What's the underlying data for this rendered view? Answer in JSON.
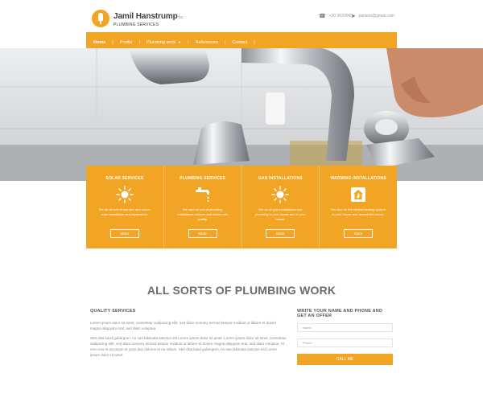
{
  "header": {
    "logo_name": "Jamil Hanstrump",
    "logo_suffix": "f.c.",
    "logo_tagline": "PLUMBING SERVICES",
    "phone": "+30 0020000",
    "email": "jamiem@gmail.com"
  },
  "nav": {
    "items": [
      {
        "label": "Home",
        "active": true
      },
      {
        "label": "Profile"
      },
      {
        "label": "Plumbing work"
      },
      {
        "label": "References"
      },
      {
        "label": "Contact"
      }
    ]
  },
  "hero": {
    "image": "faucet-repair-photo"
  },
  "services": [
    {
      "title": "SOLAR SERVICES",
      "icon": "sun-icon",
      "description": "We do all sort of sun dior and indoor solar installation and reparations.",
      "button": "More"
    },
    {
      "title": "PLUMBING SERVICES",
      "icon": "faucet-icon",
      "description": "We care all sort of plumbing installations outdoor and indoor with quality.",
      "button": "More"
    },
    {
      "title": "GAS INSTALLATIONS",
      "icon": "sun-icon",
      "description": "We do all gas installations and plumbing to your house and in your house.",
      "button": "More"
    },
    {
      "title": "WARMING INSTALLATIONS",
      "icon": "house-flame-icon",
      "description": "We also do the central heating system in your house and around the house.",
      "button": "More"
    }
  ],
  "main": {
    "title": "ALL SORTS OF PLUMBING WORK",
    "quality": {
      "heading": "QUALITY SERVICES",
      "paragraph1": "Lorem ipsum dolor sit amet, consetetur sadipscing elitr, sed diam nonumy eirmod tempor invidunt ut labore et dolore magna aliquyam erat, sed diam voluptua.",
      "paragraph2": "Stet clita kasd gubergren, no sea takimata sanctus est Lorem ipsum dolor sit amet. Lorem ipsum dolor sit amet, consetetur sadipscing elitr, sed diam nonumy eirmod tempor invidunt ut labore et dolore magna aliquyam erat, sed diam voluptua. At vero eos et accusam et justo duo dolores et ea rebum. Stet clita kasd gubergren, no sea takimata sanctus est Lorem ipsum dolor sit amet."
    },
    "form": {
      "heading": "WRITE YOUR NAME AND PHONE AND GET AN OFFER",
      "name_placeholder": "Name",
      "phone_placeholder": "Phone",
      "button": "CALL ME"
    }
  },
  "colors": {
    "accent": "#f2a524",
    "title": "#6b6b6b"
  }
}
